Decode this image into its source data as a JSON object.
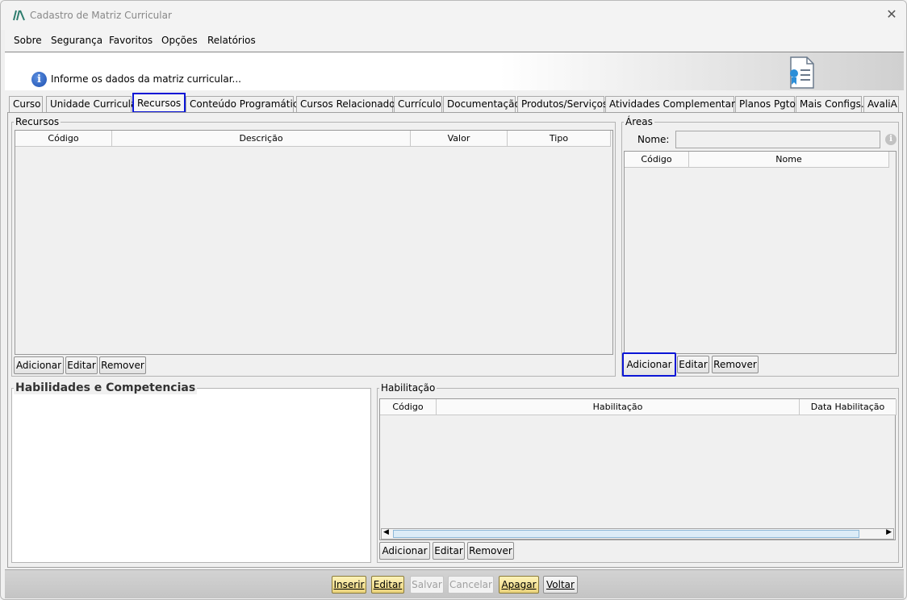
{
  "window": {
    "title": "Cadastro de Matriz Curricular"
  },
  "menu": [
    "Sobre",
    "Segurança",
    "Favoritos",
    "Opções",
    "Relatórios"
  ],
  "header": {
    "info": "Informe os dados da matriz curricular..."
  },
  "tabs": [
    "Curso",
    "Unidade Curricular",
    "Recursos",
    "Conteúdo Programático",
    "Cursos Relacionados",
    "Currículo",
    "Documentação",
    "Produtos/Serviços",
    "Atividades Complementares",
    "Planos Pgto",
    "Mais Configs.",
    "AvaliA"
  ],
  "active_tab": "Recursos",
  "recursos": {
    "title": "Recursos",
    "columns": [
      "Código",
      "Descrição",
      "Valor",
      "Tipo"
    ],
    "buttons": {
      "add": "Adicionar",
      "edit": "Editar",
      "remove": "Remover"
    }
  },
  "areas": {
    "title": "Áreas",
    "name_label": "Nome:",
    "name_value": "",
    "columns": [
      "Código",
      "Nome"
    ],
    "buttons": {
      "add": "Adicionar",
      "edit": "Editar",
      "remove": "Remover"
    }
  },
  "habilidades": {
    "title": "Habilidades e Competencias"
  },
  "habilitacao": {
    "title": "Habilitação",
    "columns": [
      "Código",
      "Habilitação",
      "Data Habilitação"
    ],
    "buttons": {
      "add": "Adicionar",
      "edit": "Editar",
      "remove": "Remover"
    }
  },
  "footer": {
    "insert": "Inserir",
    "edit": "Editar",
    "save": "Salvar",
    "cancel": "Cancelar",
    "delete": "Apagar",
    "back": "Voltar"
  }
}
